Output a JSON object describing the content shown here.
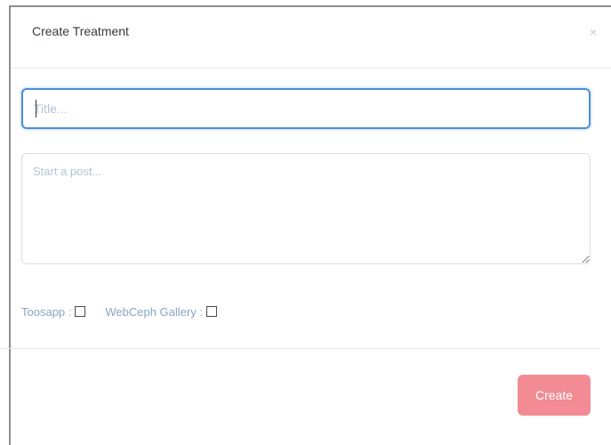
{
  "modal": {
    "title": "Create Treatment",
    "close_label": "×"
  },
  "form": {
    "title_placeholder": "Title...",
    "title_value": "",
    "post_placeholder": "Start a post...",
    "post_value": ""
  },
  "options": [
    {
      "label": "Toosapp :",
      "checked": false
    },
    {
      "label": "WebCeph Gallery :",
      "checked": false
    }
  ],
  "footer": {
    "create_label": "Create"
  },
  "colors": {
    "focus_border": "#4a8fd6",
    "create_button": "#f28b94",
    "label_text": "#8aa5c4"
  }
}
